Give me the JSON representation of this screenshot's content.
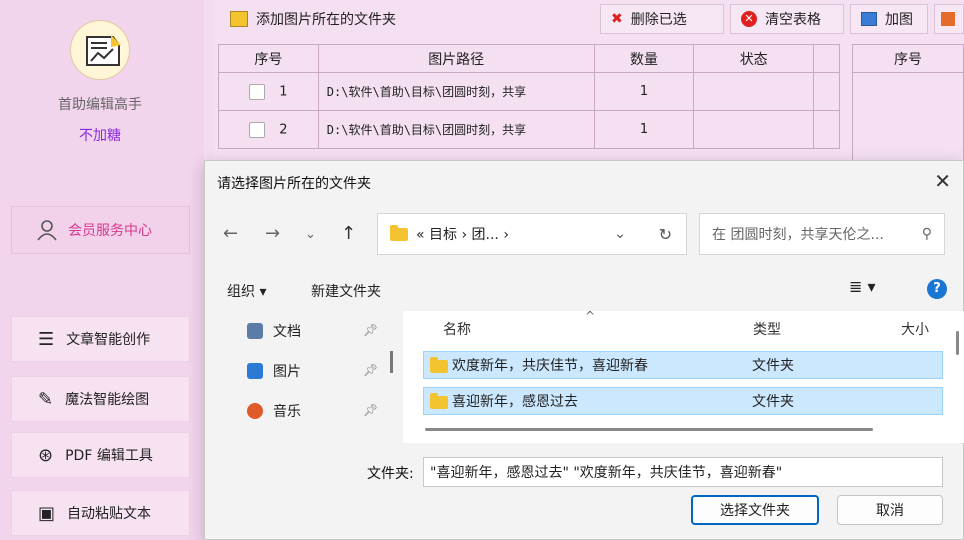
{
  "sidebar": {
    "app_name": "首助编辑高手",
    "app_sub": "不加糖",
    "member_label": "会员服务中心",
    "nav": [
      {
        "label": "文章智能创作",
        "icon": "menu-icon"
      },
      {
        "label": "魔法智能绘图",
        "icon": "paint-icon"
      },
      {
        "label": "PDF 编辑工具",
        "icon": "pdf-icon"
      },
      {
        "label": "自动粘贴文本",
        "icon": "paste-icon"
      }
    ]
  },
  "toolbar": {
    "add_folder": "添加图片所在的文件夹",
    "delete_selected": "删除已选",
    "clear_table": "清空表格",
    "add_image": "加图"
  },
  "table": {
    "headers": [
      "序号",
      "图片路径",
      "数量",
      "状态"
    ],
    "rows": [
      {
        "index": "1",
        "path": "D:\\软件\\首助\\目标\\团圆时刻，共享",
        "count": "1",
        "status": ""
      },
      {
        "index": "2",
        "path": "D:\\软件\\首助\\目标\\团圆时刻，共享",
        "count": "1",
        "status": ""
      }
    ],
    "right_header": "序号"
  },
  "dialog": {
    "title": "请选择图片所在的文件夹",
    "address": "« 目标 › 团... ›",
    "search_placeholder": "在 团圆时刻，共享天伦之...",
    "organize": "组织 ▾",
    "new_folder": "新建文件夹",
    "nav_items": [
      {
        "label": "文档",
        "color": "#5b7ba8"
      },
      {
        "label": "图片",
        "color": "#2a7ad6"
      },
      {
        "label": "音乐",
        "color": "#e05a2a"
      }
    ],
    "columns": {
      "name": "名称",
      "type": "类型",
      "size": "大小"
    },
    "files": [
      {
        "name": "欢度新年，共庆佳节，喜迎新春",
        "type": "文件夹"
      },
      {
        "name": "喜迎新年，感恩过去",
        "type": "文件夹"
      }
    ],
    "folder_label": "文件夹:",
    "folder_value": "\"喜迎新年，感恩过去\" \"欢度新年，共庆佳节，喜迎新春\"",
    "select_button": "选择文件夹",
    "cancel_button": "取消"
  }
}
